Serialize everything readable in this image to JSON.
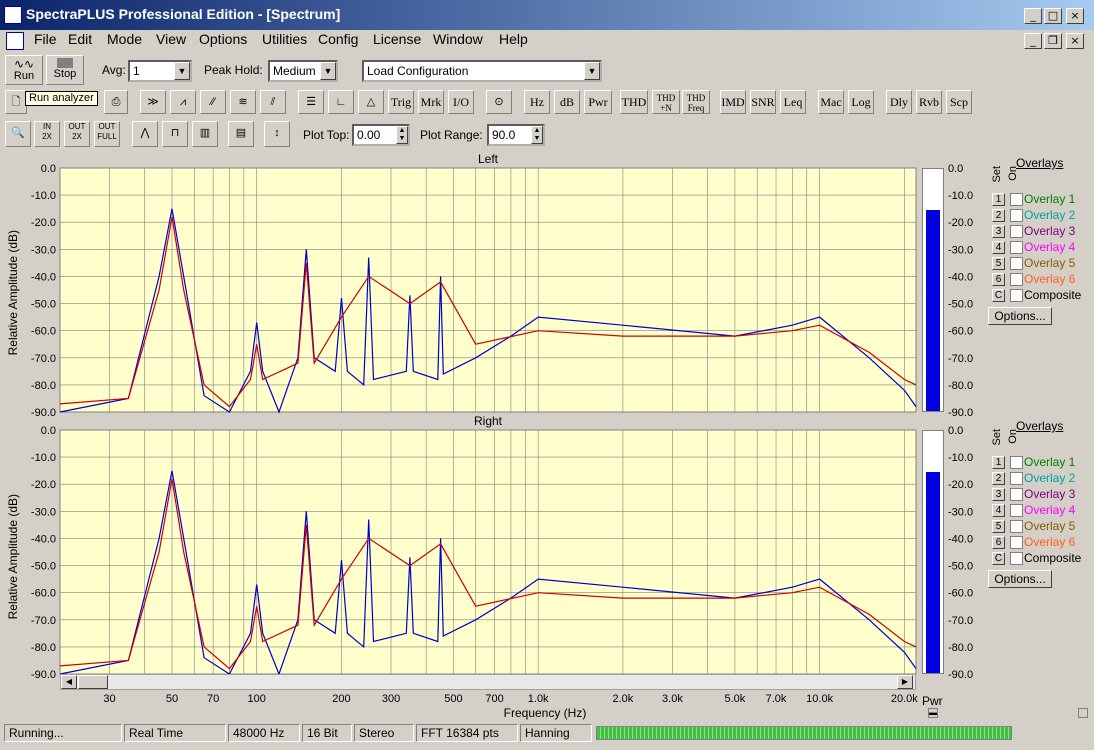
{
  "window": {
    "title": "SpectraPLUS Professional Edition - [Spectrum]"
  },
  "menu": [
    "File",
    "Edit",
    "Mode",
    "View",
    "Options",
    "Utilities",
    "Config",
    "License",
    "Window",
    "Help"
  ],
  "toolbar1": {
    "run": "Run",
    "stop": "Stop",
    "avg_label": "Avg:",
    "avg_value": "1",
    "peak_label": "Peak Hold:",
    "peak_value": "Medium",
    "config_value": "Load Configuration"
  },
  "tooltip": "Run analyzer",
  "toolbar2": [
    "Trig",
    "Mrk",
    "I/O",
    "Hz",
    "dB",
    "Pwr",
    "THD",
    "THD +N",
    "THD Freq",
    "IMD",
    "SNR",
    "Leq",
    "Mac",
    "Log",
    "Dly",
    "Rvb",
    "Scp"
  ],
  "toolbar3": {
    "plot_top_label": "Plot Top:",
    "plot_top_value": "0.00",
    "plot_range_label": "Plot Range:",
    "plot_range_value": "90.0"
  },
  "chart_data": [
    {
      "type": "line",
      "title": "Left",
      "ylabel": "Relative Amplitude (dB)",
      "ylim": [
        -90,
        0
      ],
      "yticks": [
        "0.0",
        "-10.0",
        "-20.0",
        "-30.0",
        "-40.0",
        "-50.0",
        "-60.0",
        "-70.0",
        "-80.0",
        "-90.0"
      ],
      "xscale": "log",
      "xlim": [
        20,
        22000
      ],
      "series": [
        {
          "color": "#0000cc",
          "x": [
            20,
            35,
            45,
            50,
            55,
            65,
            80,
            95,
            100,
            105,
            120,
            140,
            150,
            160,
            190,
            200,
            210,
            240,
            250,
            260,
            340,
            350,
            360,
            440,
            450,
            460,
            600,
            800,
            1000,
            2000,
            5000,
            8000,
            10000,
            15000,
            20000,
            22000
          ],
          "y": [
            -90,
            -85,
            -40,
            -15,
            -40,
            -84,
            -90,
            -75,
            -57,
            -75,
            -90,
            -70,
            -30,
            -70,
            -75,
            -48,
            -75,
            -80,
            -33,
            -78,
            -75,
            -47,
            -75,
            -78,
            -40,
            -76,
            -70,
            -62,
            -55,
            -58,
            -62,
            -58,
            -55,
            -70,
            -82,
            -88
          ]
        },
        {
          "color": "#cc0000",
          "x": [
            20,
            35,
            45,
            50,
            55,
            65,
            80,
            95,
            100,
            105,
            140,
            150,
            160,
            200,
            250,
            350,
            450,
            600,
            1000,
            2000,
            5000,
            8000,
            10000,
            15000,
            20000,
            22000
          ],
          "y": [
            -87,
            -85,
            -45,
            -18,
            -45,
            -80,
            -88,
            -78,
            -65,
            -78,
            -72,
            -35,
            -72,
            -55,
            -40,
            -50,
            -42,
            -65,
            -60,
            -62,
            -62,
            -60,
            -58,
            -68,
            -78,
            -80
          ]
        }
      ]
    },
    {
      "type": "line",
      "title": "Right",
      "ylabel": "Relative Amplitude (dB)",
      "xlabel": "Frequency (Hz)",
      "ylim": [
        -90,
        0
      ],
      "yticks": [
        "0.0",
        "-10.0",
        "-20.0",
        "-30.0",
        "-40.0",
        "-50.0",
        "-60.0",
        "-70.0",
        "-80.0",
        "-90.0"
      ],
      "xscale": "log",
      "xlim": [
        20,
        22000
      ],
      "xticks": [
        "30",
        "50",
        "70",
        "100",
        "200",
        "300",
        "500",
        "700",
        "1.0k",
        "2.0k",
        "3.0k",
        "5.0k",
        "7.0k",
        "10.0k",
        "20.0k"
      ],
      "series": [
        {
          "color": "#0000cc",
          "x": [
            20,
            35,
            45,
            50,
            55,
            65,
            80,
            95,
            100,
            105,
            120,
            140,
            150,
            160,
            190,
            200,
            210,
            240,
            250,
            260,
            340,
            350,
            360,
            440,
            450,
            460,
            600,
            800,
            1000,
            2000,
            5000,
            8000,
            10000,
            15000,
            20000,
            22000
          ],
          "y": [
            -90,
            -85,
            -40,
            -15,
            -40,
            -84,
            -90,
            -75,
            -57,
            -75,
            -90,
            -70,
            -30,
            -70,
            -75,
            -48,
            -75,
            -80,
            -33,
            -78,
            -75,
            -47,
            -75,
            -78,
            -40,
            -76,
            -70,
            -62,
            -55,
            -58,
            -62,
            -58,
            -55,
            -70,
            -82,
            -88
          ]
        },
        {
          "color": "#cc0000",
          "x": [
            20,
            35,
            45,
            50,
            55,
            65,
            80,
            95,
            100,
            105,
            140,
            150,
            160,
            200,
            250,
            350,
            450,
            600,
            1000,
            2000,
            5000,
            8000,
            10000,
            15000,
            20000,
            22000
          ],
          "y": [
            -87,
            -85,
            -45,
            -18,
            -45,
            -80,
            -88,
            -78,
            -65,
            -78,
            -72,
            -35,
            -72,
            -55,
            -40,
            -50,
            -42,
            -65,
            -60,
            -62,
            -62,
            -60,
            -58,
            -68,
            -78,
            -80
          ]
        }
      ]
    }
  ],
  "meters": {
    "label": "Pwr",
    "left_level_db": -14,
    "right_level_db": -14
  },
  "overlays": {
    "title": "Overlays",
    "set_label": "Set",
    "on_label": "On",
    "items": [
      {
        "num": "1",
        "label": "Overlay 1",
        "color": "#008000"
      },
      {
        "num": "2",
        "label": "Overlay 2",
        "color": "#00a0a0"
      },
      {
        "num": "3",
        "label": "Overlay 3",
        "color": "#800080"
      },
      {
        "num": "4",
        "label": "Overlay 4",
        "color": "#ff00ff"
      },
      {
        "num": "5",
        "label": "Overlay 5",
        "color": "#806000"
      },
      {
        "num": "6",
        "label": "Overlay 6",
        "color": "#ff6020"
      },
      {
        "num": "C",
        "label": "Composite",
        "color": "#000000"
      }
    ],
    "options": "Options..."
  },
  "status": {
    "state": "Running...",
    "mode": "Real Time",
    "rate": "48000 Hz",
    "bits": "16 Bit",
    "channels": "Stereo",
    "fft": "FFT 16384 pts",
    "window": "Hanning"
  }
}
